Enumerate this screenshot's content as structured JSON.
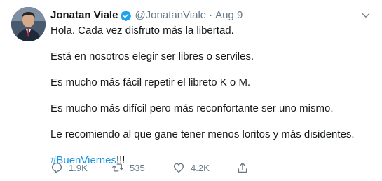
{
  "tweet": {
    "author_name": "Jonatan Viale",
    "author_handle": "@JonatanViale",
    "separator": "·",
    "date": "Aug 9",
    "paragraphs": [
      "Hola. Cada vez disfruto más la libertad.",
      "Está en nosotros elegir ser libres o serviles.",
      "Es mucho más fácil repetir el libreto K o M.",
      "Es mucho más difícil pero más reconfortante ser uno mismo.",
      "Le recomiendo al que gane tener menos loritos y más disidentes."
    ],
    "hashtag": "#BuenViernes",
    "hashtag_suffix": "!!!",
    "reply_count": "1.9K",
    "retweet_count": "535",
    "like_count": "4.2K"
  },
  "colors": {
    "text": "#14171a",
    "muted": "#657786",
    "link": "#1b95e0",
    "verified": "#1da1f2"
  },
  "icons": [
    "verified-badge-icon",
    "chevron-down-icon",
    "reply-icon",
    "retweet-icon",
    "like-icon",
    "share-icon"
  ]
}
